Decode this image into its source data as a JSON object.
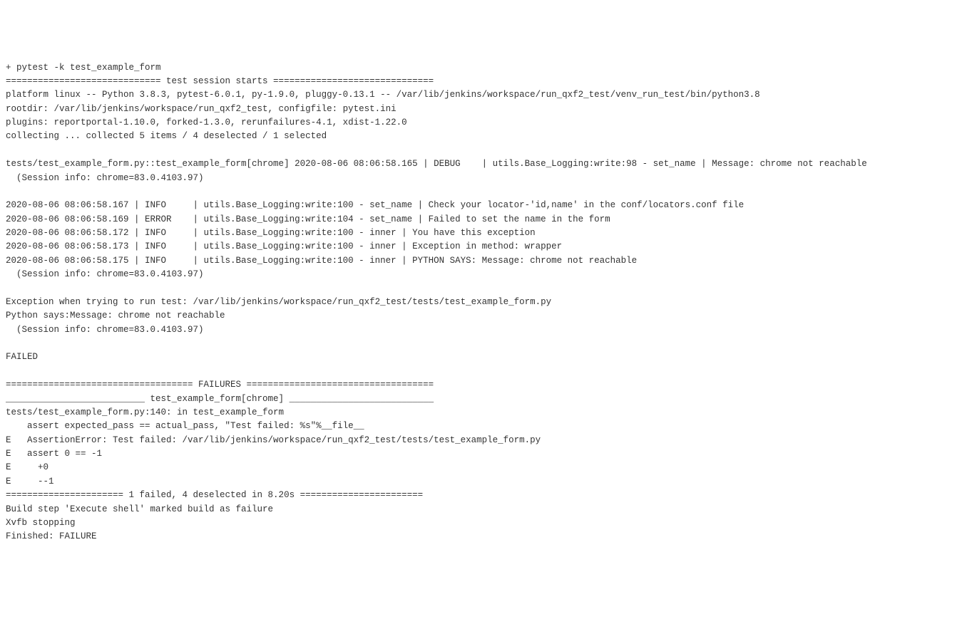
{
  "terminal": {
    "lines": [
      "+ pytest -k test_example_form",
      "============================= test session starts ==============================",
      "platform linux -- Python 3.8.3, pytest-6.0.1, py-1.9.0, pluggy-0.13.1 -- /var/lib/jenkins/workspace/run_qxf2_test/venv_run_test/bin/python3.8",
      "rootdir: /var/lib/jenkins/workspace/run_qxf2_test, configfile: pytest.ini",
      "plugins: reportportal-1.10.0, forked-1.3.0, rerunfailures-4.1, xdist-1.22.0",
      "collecting ... collected 5 items / 4 deselected / 1 selected",
      "",
      "tests/test_example_form.py::test_example_form[chrome] 2020-08-06 08:06:58.165 | DEBUG    | utils.Base_Logging:write:98 - set_name | Message: chrome not reachable",
      "  (Session info: chrome=83.0.4103.97)",
      "",
      "2020-08-06 08:06:58.167 | INFO     | utils.Base_Logging:write:100 - set_name | Check your locator-'id,name' in the conf/locators.conf file",
      "2020-08-06 08:06:58.169 | ERROR    | utils.Base_Logging:write:104 - set_name | Failed to set the name in the form",
      "2020-08-06 08:06:58.172 | INFO     | utils.Base_Logging:write:100 - inner | You have this exception",
      "2020-08-06 08:06:58.173 | INFO     | utils.Base_Logging:write:100 - inner | Exception in method: wrapper",
      "2020-08-06 08:06:58.175 | INFO     | utils.Base_Logging:write:100 - inner | PYTHON SAYS: Message: chrome not reachable",
      "  (Session info: chrome=83.0.4103.97)",
      "",
      "Exception when trying to run test: /var/lib/jenkins/workspace/run_qxf2_test/tests/test_example_form.py",
      "Python says:Message: chrome not reachable",
      "  (Session info: chrome=83.0.4103.97)",
      "",
      "FAILED",
      "",
      "=================================== FAILURES ===================================",
      "__________________________ test_example_form[chrome] ___________________________",
      "tests/test_example_form.py:140: in test_example_form",
      "    assert expected_pass == actual_pass, \"Test failed: %s\"%__file__",
      "E   AssertionError: Test failed: /var/lib/jenkins/workspace/run_qxf2_test/tests/test_example_form.py",
      "E   assert 0 == -1",
      "E     +0",
      "E     --1",
      "====================== 1 failed, 4 deselected in 8.20s =======================",
      "Build step 'Execute shell' marked build as failure",
      "Xvfb stopping",
      "Finished: FAILURE"
    ]
  }
}
